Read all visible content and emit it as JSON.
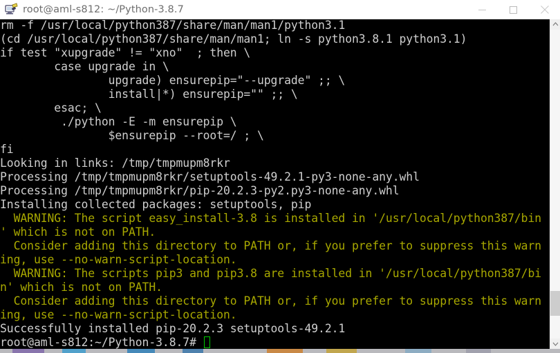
{
  "window": {
    "title": "root@aml-s812: ~/Python-3.8.7",
    "icon": "putty-terminal-icon",
    "controls": {
      "minimize": "minimize-button",
      "maximize": "maximize-button",
      "close": "close-button"
    }
  },
  "colors": {
    "titlebar_bg": "#ffffff",
    "title_text": "#6e6e6e",
    "terminal_bg": "#000000",
    "terminal_fg": "#cfcfcf",
    "warning_fg": "#a8a800",
    "cursor": "#00cc00",
    "scrollbar_track": "#f6f6f6",
    "scrollbar_thumb": "#cdcdcd"
  },
  "terminal": {
    "prompt": "root@aml-s812:~/Python-3.8.7#",
    "cursor_visible": true,
    "lines": [
      {
        "text": "rm -f /usr/local/python387/share/man/man1/python3.1",
        "color": "normal"
      },
      {
        "text": "(cd /usr/local/python387/share/man/man1; ln -s python3.8.1 python3.1)",
        "color": "normal"
      },
      {
        "text": "if test \"xupgrade\" != \"xno\"  ; then \\",
        "color": "normal"
      },
      {
        "text": "        case upgrade in \\",
        "color": "normal"
      },
      {
        "text": "                upgrade) ensurepip=\"--upgrade\" ;; \\",
        "color": "normal"
      },
      {
        "text": "                install|*) ensurepip=\"\" ;; \\",
        "color": "normal"
      },
      {
        "text": "        esac; \\",
        "color": "normal"
      },
      {
        "text": "         ./python -E -m ensurepip \\",
        "color": "normal"
      },
      {
        "text": "                $ensurepip --root=/ ; \\",
        "color": "normal"
      },
      {
        "text": "fi",
        "color": "normal"
      },
      {
        "text": "Looking in links: /tmp/tmpmupm8rkr",
        "color": "normal"
      },
      {
        "text": "Processing /tmp/tmpmupm8rkr/setuptools-49.2.1-py3-none-any.whl",
        "color": "normal"
      },
      {
        "text": "Processing /tmp/tmpmupm8rkr/pip-20.2.3-py2.py3-none-any.whl",
        "color": "normal"
      },
      {
        "text": "Installing collected packages: setuptools, pip",
        "color": "normal"
      },
      {
        "text": "  WARNING: The script easy_install-3.8 is installed in '/usr/local/python387/bin",
        "color": "warn"
      },
      {
        "text": "' which is not on PATH.",
        "color": "warn"
      },
      {
        "text": "  Consider adding this directory to PATH or, if you prefer to suppress this warn",
        "color": "warn"
      },
      {
        "text": "ing, use --no-warn-script-location.",
        "color": "warn"
      },
      {
        "text": "  WARNING: The scripts pip3 and pip3.8 are installed in '/usr/local/python387/bi",
        "color": "warn"
      },
      {
        "text": "n' which is not on PATH.",
        "color": "warn"
      },
      {
        "text": "  Consider adding this directory to PATH or, if you prefer to suppress this warn",
        "color": "warn"
      },
      {
        "text": "ing, use --no-warn-script-location.",
        "color": "warn"
      },
      {
        "text": "Successfully installed pip-20.2.3 setuptools-49.2.1",
        "color": "normal"
      }
    ]
  },
  "scrollbar": {
    "up_arrow": "scroll-up-arrow-icon",
    "down_arrow": "scroll-down-arrow-icon",
    "thumb_position_pct": 92
  },
  "desktop_strip": {
    "icon_colors": [
      "#7a5fa8",
      "#2f9ad0",
      "#1f7ab8",
      "#2b6fa8",
      "#cf7a1f",
      "#c4a02a",
      "#7fa8c4",
      "#9a9aa8"
    ]
  }
}
